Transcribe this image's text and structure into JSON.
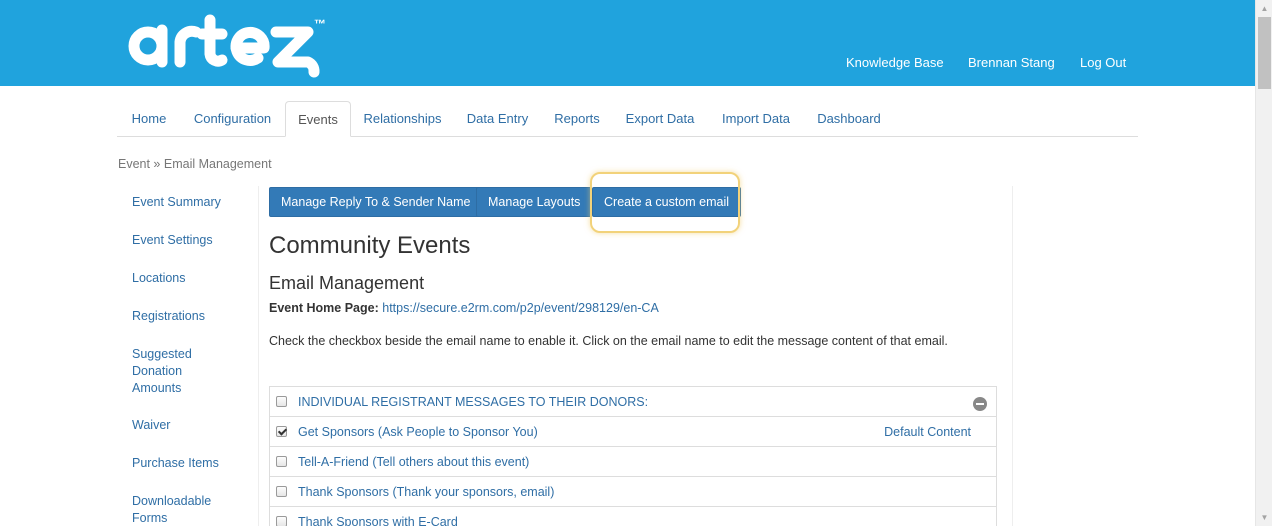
{
  "brand": {
    "logo_text": "artez",
    "trademark": "™",
    "header_bg": "#20a3dd"
  },
  "header_nav": {
    "knowledge_base": "Knowledge Base",
    "user_name": "Brennan Stang",
    "log_out": "Log Out"
  },
  "tabs": [
    {
      "label": "Home"
    },
    {
      "label": "Configuration"
    },
    {
      "label": "Events",
      "active": true
    },
    {
      "label": "Relationships"
    },
    {
      "label": "Data Entry"
    },
    {
      "label": "Reports"
    },
    {
      "label": "Export Data"
    },
    {
      "label": "Import Data"
    },
    {
      "label": "Dashboard"
    }
  ],
  "breadcrumb": "Event » Email Management",
  "sidebar": {
    "items": [
      {
        "label": "Event Summary"
      },
      {
        "label": "Event Settings"
      },
      {
        "label": "Locations"
      },
      {
        "label": "Registrations"
      },
      {
        "label": "Suggested Donation Amounts"
      },
      {
        "label": "Waiver"
      },
      {
        "label": "Purchase Items"
      },
      {
        "label": "Downloadable Forms"
      }
    ]
  },
  "toolbar": {
    "manage_reply_label": "Manage Reply To & Sender Name",
    "manage_layouts_label": "Manage Layouts",
    "create_custom_label": "Create a custom email"
  },
  "main": {
    "event_title": "Community Events",
    "section_title": "Email Management",
    "home_page_label": "Event Home Page:",
    "home_page_url": "https://secure.e2rm.com/p2p/event/298129/en-CA",
    "instructions": "Check the checkbox beside the email name to enable it. Click on the email name to edit the message content of that email."
  },
  "email_table": {
    "group_header": "INDIVIDUAL REGISTRANT MESSAGES TO THEIR DONORS:",
    "rows": [
      {
        "name": "Get Sponsors (Ask People to Sponsor You)",
        "checked": true,
        "status": "Default Content"
      },
      {
        "name": "Tell-A-Friend (Tell others about this event)",
        "checked": false
      },
      {
        "name": "Thank Sponsors (Thank your sponsors, email)",
        "checked": false
      },
      {
        "name": "Thank Sponsors with E-Card",
        "checked": false
      }
    ]
  },
  "colors": {
    "accent_button": "#337ab7",
    "link": "#2f6ea5",
    "highlight_ring": "#f2d27a"
  }
}
